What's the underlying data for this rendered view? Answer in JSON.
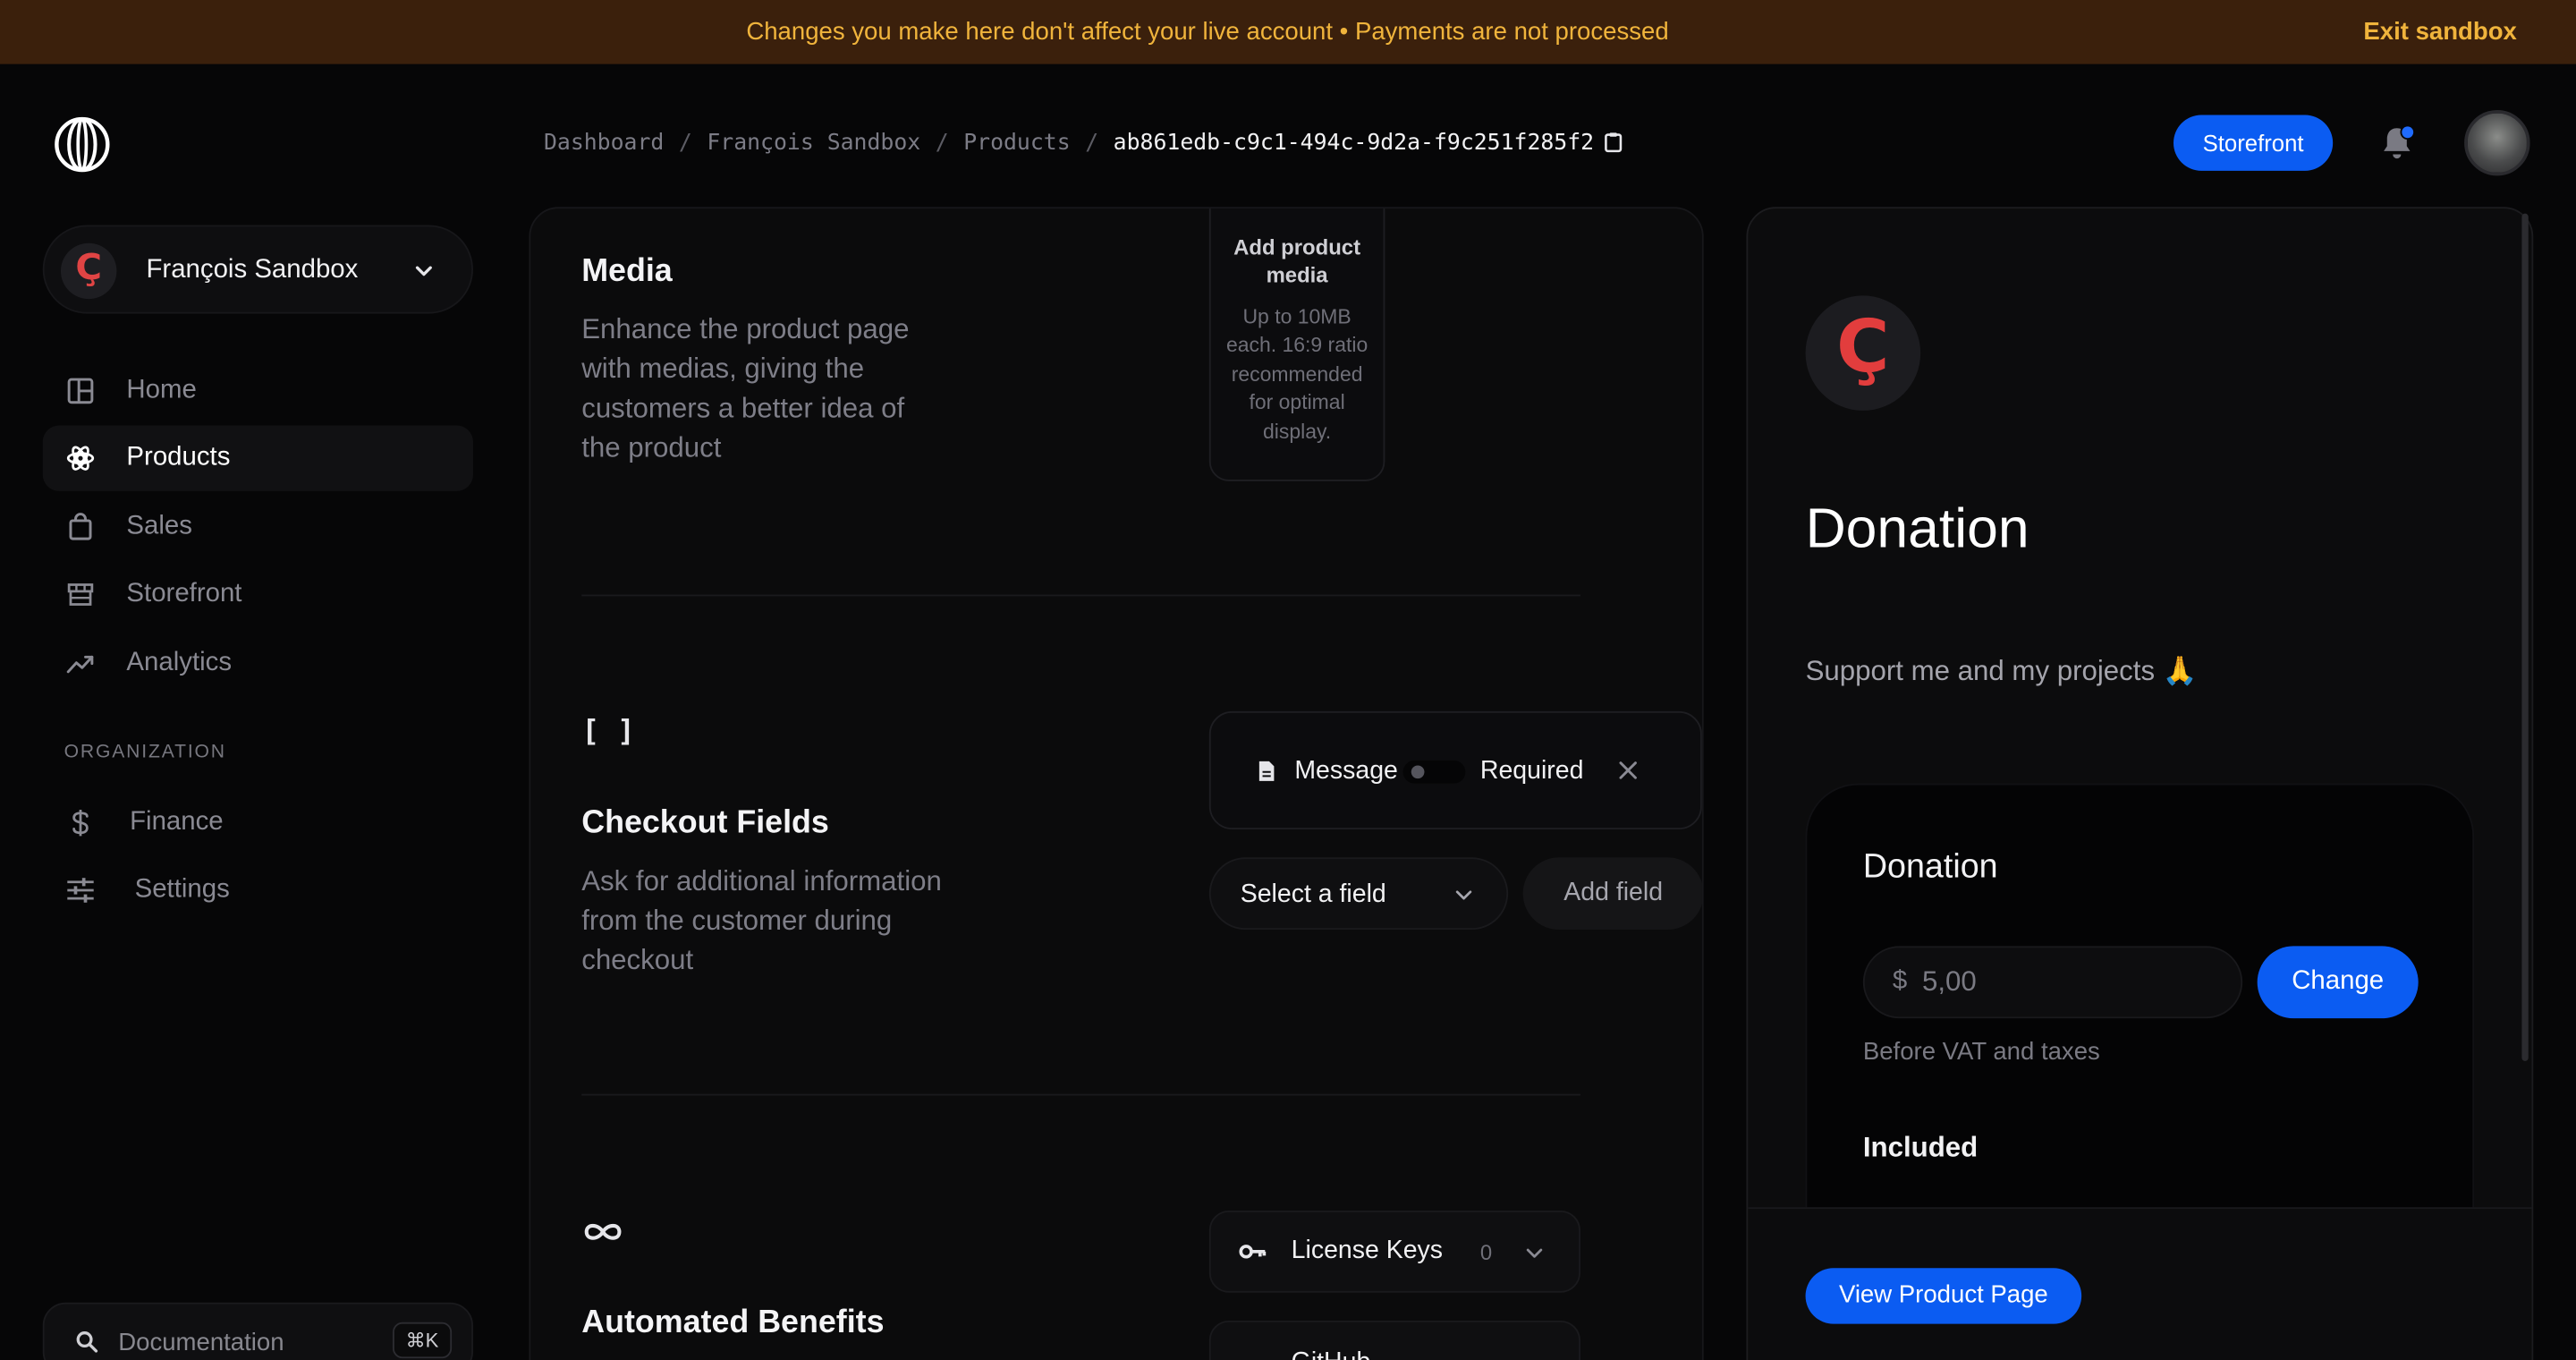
{
  "banner": {
    "message": "Changes you make here don't affect your live account • Payments are not processed",
    "exit_label": "Exit sandbox"
  },
  "organization": {
    "avatar_letter": "Ç",
    "name": "François Sandbox"
  },
  "nav": {
    "items": [
      {
        "label": "Home",
        "icon": "home-icon"
      },
      {
        "label": "Products",
        "icon": "products-icon",
        "active": true
      },
      {
        "label": "Sales",
        "icon": "sales-icon"
      },
      {
        "label": "Storefront",
        "icon": "storefront-icon"
      },
      {
        "label": "Analytics",
        "icon": "analytics-icon"
      }
    ],
    "section_label": "ORGANIZATION",
    "org_items": [
      {
        "label": "Finance",
        "icon": "dollar-icon"
      },
      {
        "label": "Settings",
        "icon": "sliders-icon"
      }
    ]
  },
  "docs": {
    "label": "Documentation",
    "shortcut": "⌘K"
  },
  "breadcrumbs": [
    "Dashboard",
    "François Sandbox",
    "Products",
    "ab861edb-c9c1-494c-9d2a-f9c251f285f2"
  ],
  "header": {
    "storefront_label": "Storefront"
  },
  "media": {
    "title": "Media",
    "description": "Enhance the product page with medias, giving the customers a better idea of the product",
    "drop_title": "Add product media",
    "drop_subtitle": "Up to 10MB each. 16:9 ratio recommended for optimal display."
  },
  "checkout": {
    "icon_glyph": "[ ]",
    "title": "Checkout Fields",
    "description": "Ask for additional information from the customer during checkout",
    "field_name": "Message",
    "required_label": "Required",
    "required_on": false,
    "select_placeholder": "Select a field",
    "add_label": "Add field"
  },
  "benefits": {
    "title": "Automated Benefits",
    "rows": [
      {
        "label": "License Keys",
        "count": "0"
      },
      {
        "label": "GitHub"
      }
    ]
  },
  "preview": {
    "logo_letter": "Ç",
    "title": "Donation",
    "description": "Support me and my projects 🙏",
    "card_title": "Donation",
    "currency": "$",
    "amount": "5,00",
    "change_label": "Change",
    "vat_note": "Before VAT and taxes",
    "included_label": "Included",
    "view_label": "View Product Page"
  },
  "colors": {
    "accent": "#0b5cf2",
    "banner_bg": "#3b200c",
    "banner_text": "#f0b43c",
    "brand_red": "#e23d3d"
  }
}
